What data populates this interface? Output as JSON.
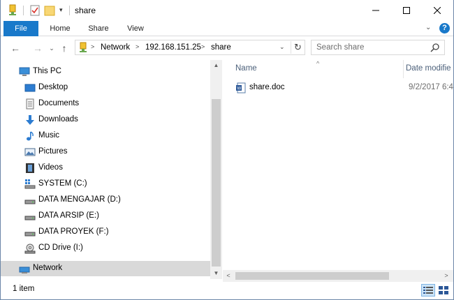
{
  "window": {
    "title": "share",
    "minimize": "—",
    "maximize": "☐",
    "close": "✕"
  },
  "quick_access": {
    "dropdown": "▾"
  },
  "ribbon": {
    "tabs": [
      {
        "label": "File",
        "active": true
      },
      {
        "label": "Home"
      },
      {
        "label": "Share"
      },
      {
        "label": "View"
      }
    ],
    "help": "?",
    "chevron": "⌄"
  },
  "navigation": {
    "back": "←",
    "forward": "→",
    "recent": "⌄",
    "up": "↑",
    "breadcrumb": [
      "Network",
      "192.168.151.25",
      "share"
    ],
    "breadcrumb_sep": ">",
    "address_dropdown": "⌄",
    "refresh": "↻",
    "search_placeholder": "Search share"
  },
  "nav_pane": {
    "items": [
      {
        "label": "This PC",
        "icon": "this-pc-icon"
      },
      {
        "label": "Desktop",
        "icon": "desktop-icon"
      },
      {
        "label": "Documents",
        "icon": "documents-icon"
      },
      {
        "label": "Downloads",
        "icon": "downloads-icon"
      },
      {
        "label": "Music",
        "icon": "music-icon"
      },
      {
        "label": "Pictures",
        "icon": "pictures-icon"
      },
      {
        "label": "Videos",
        "icon": "videos-icon"
      },
      {
        "label": "SYSTEM (C:)",
        "icon": "system-drive-icon"
      },
      {
        "label": "DATA MENGAJAR (D:)",
        "icon": "drive-icon"
      },
      {
        "label": "DATA ARSIP (E:)",
        "icon": "drive-icon"
      },
      {
        "label": "DATA PROYEK (F:)",
        "icon": "drive-icon"
      },
      {
        "label": "CD Drive (I:)",
        "icon": "cd-drive-icon"
      },
      {
        "label": "Network",
        "icon": "network-icon",
        "selected": true
      }
    ],
    "scroll_up": "▲",
    "scroll_down": "▼"
  },
  "content": {
    "columns": {
      "name": "Name",
      "date": "Date modifie"
    },
    "sort_caret": "^",
    "files": [
      {
        "name": "share.doc",
        "date": "9/2/2017 6:4",
        "icon": "word-document-icon"
      }
    ],
    "scroll_left": "<",
    "scroll_right": ">"
  },
  "status": {
    "item_count": "1 item"
  },
  "colors": {
    "file_tab": "#1979ca",
    "selection": "#d9d9d9",
    "column_header_text": "#4c607a"
  }
}
